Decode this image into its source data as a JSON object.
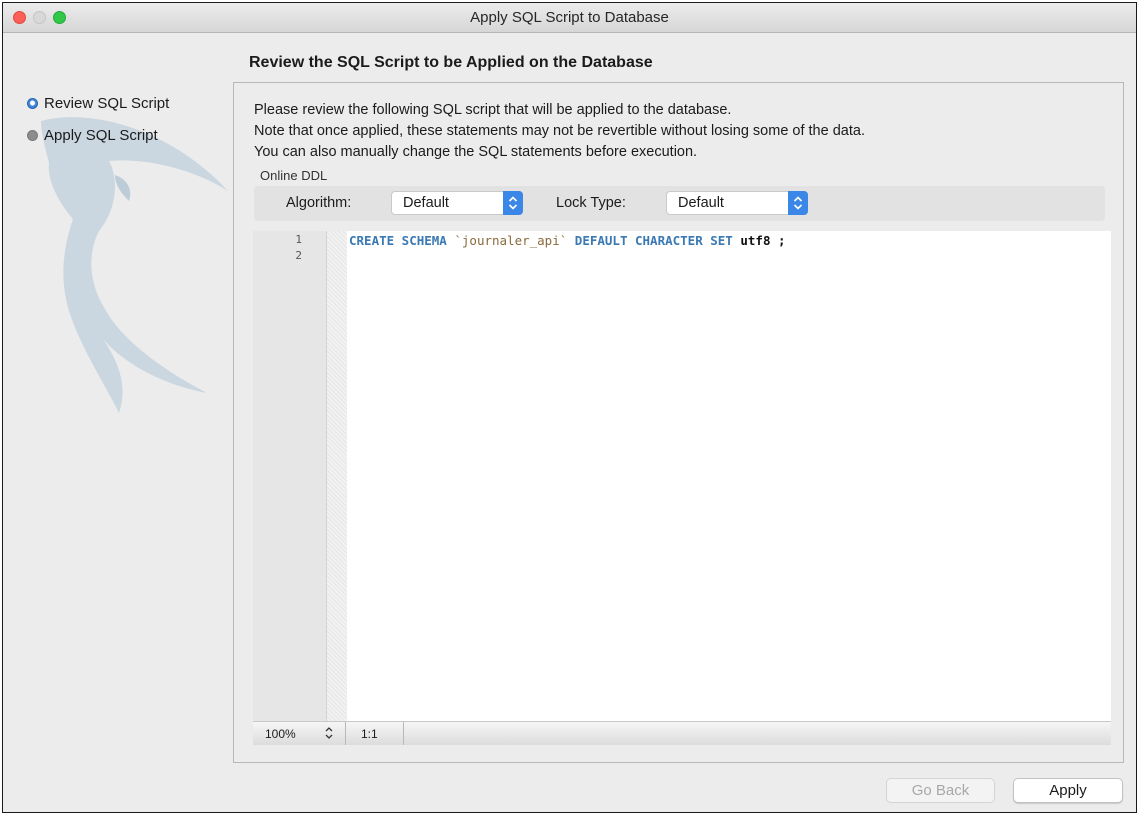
{
  "window": {
    "title": "Apply SQL Script to Database"
  },
  "page": {
    "title": "Review the SQL Script to be Applied on the Database"
  },
  "steps": [
    {
      "label": "Review SQL Script",
      "active": true
    },
    {
      "label": "Apply SQL Script",
      "active": false
    }
  ],
  "description": [
    "Please review the following SQL script that will be applied to the database.",
    "Note that once applied, these statements may not be revertible without losing some of the data.",
    "You can also manually change the SQL statements before execution."
  ],
  "online_ddl": {
    "label": "Online DDL",
    "algorithm_label": "Algorithm:",
    "algorithm_value": "Default",
    "lock_type_label": "Lock Type:",
    "lock_type_value": "Default"
  },
  "editor": {
    "line_numbers": [
      "1",
      "2"
    ],
    "code": {
      "kw1": "CREATE SCHEMA",
      "str": "`journaler_api`",
      "kw2": "DEFAULT CHARACTER SET",
      "plain": "utf8 ;"
    },
    "zoom": "100%",
    "cursor_position": "1:1"
  },
  "buttons": {
    "back": "Go Back",
    "apply": "Apply"
  },
  "colors": {
    "accent": "#3a87e8",
    "keyword": "#3a79b3",
    "string": "#8a6a3c"
  }
}
